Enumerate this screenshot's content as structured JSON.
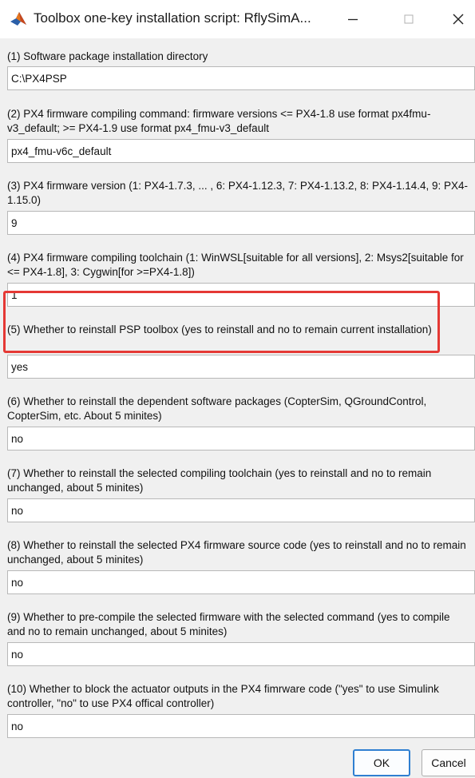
{
  "window": {
    "title": "Toolbox one-key installation script: RflySimA...",
    "icon": "matlab-icon",
    "colors": {
      "highlight": "#e53935",
      "ok_border": "#2f7fd1"
    }
  },
  "fields": [
    {
      "label": "(1) Software package installation directory",
      "value": "C:\\PX4PSP"
    },
    {
      "label": "(2) PX4 firmware compiling command: firmware versions <= PX4-1.8 use format px4fmu-v3_default; >= PX4-1.9 use format px4_fmu-v3_default",
      "value": "px4_fmu-v6c_default"
    },
    {
      "label": "(3) PX4 firmware version (1: PX4-1.7.3, ... , 6: PX4-1.12.3, 7: PX4-1.13.2, 8: PX4-1.14.4, 9: PX4-1.15.0)",
      "value": "9"
    },
    {
      "label": "(4) PX4 firmware compiling toolchain (1: WinWSL[suitable for all versions], 2: Msys2[suitable for <= PX4-1.8], 3: Cygwin[for >=PX4-1.8])",
      "value": "1"
    },
    {
      "label": "(5) Whether to reinstall PSP toolbox (yes to reinstall and no to remain current installation)",
      "value": "yes"
    },
    {
      "label": "(6) Whether to reinstall the dependent software packages (CopterSim, QGroundControl, CopterSim, etc. About 5 minites)",
      "value": "no"
    },
    {
      "label": "(7) Whether to reinstall the selected compiling toolchain (yes to reinstall and no to remain unchanged, about 5 minites)",
      "value": "no"
    },
    {
      "label": "(8) Whether to reinstall the selected PX4 firmware source code (yes to reinstall and no to remain unchanged, about 5 minites)",
      "value": "no"
    },
    {
      "label": "(9) Whether to pre-compile the selected firmware with the selected command (yes to compile and no to remain unchanged, about 5 minites)",
      "value": "no"
    },
    {
      "label": "(10) Whether to block the actuator outputs in the PX4 fimrware code (\"yes\" to use Simulink controller, \"no\" to use PX4 offical controller)",
      "value": "no"
    }
  ],
  "buttons": {
    "ok": "OK",
    "cancel": "Cancel"
  }
}
